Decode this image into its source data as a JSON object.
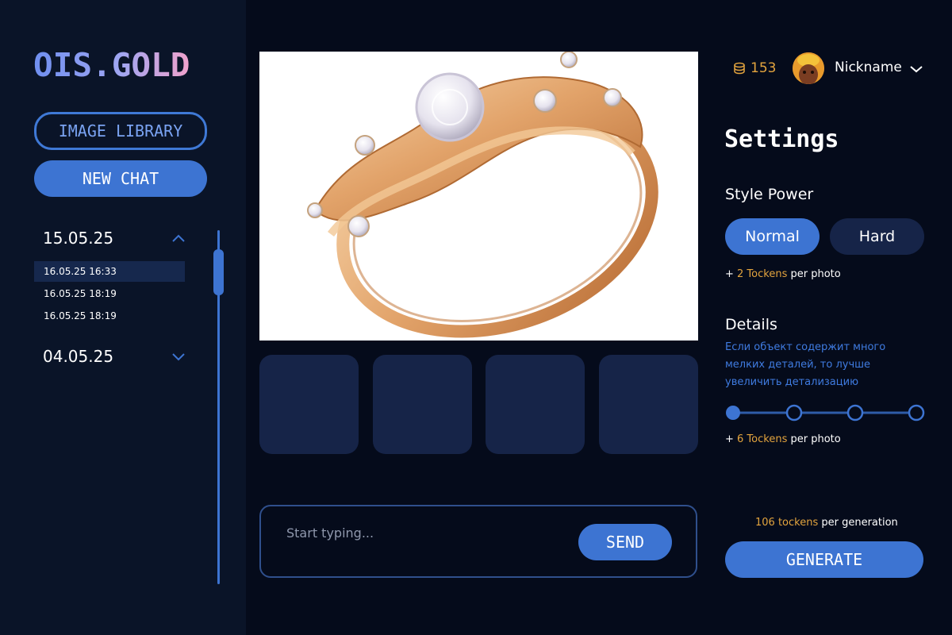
{
  "app": {
    "logo": "OIS.GOLD"
  },
  "sidebar": {
    "library_button": "IMAGE LIBRARY",
    "new_chat_button": "NEW CHAT",
    "groups": [
      {
        "date": "15.05.25",
        "expanded": true,
        "items": [
          "16.05.25 16:33",
          "16.05.25 18:19",
          "16.05.25 18:19"
        ],
        "active_index": 0
      },
      {
        "date": "04.05.25",
        "expanded": false
      }
    ]
  },
  "main": {
    "image_icon": "gold-ring-image",
    "thumbnails_count": 4,
    "chat": {
      "placeholder": "Start typing...",
      "value": "",
      "send_label": "SEND"
    }
  },
  "header": {
    "coin_icon": "coin-stack-icon",
    "coins": "153",
    "nickname": "Nickname"
  },
  "settings": {
    "title": "Settings",
    "style_power": {
      "title": "Style Power",
      "options": [
        "Normal",
        "Hard"
      ],
      "selected": "Normal",
      "note_prefix": "+ ",
      "note_tokens": "2 Tockens",
      "note_suffix": " per photo"
    },
    "details": {
      "title": "Details",
      "description": "Если объект содержит много мелких деталей, то лучше увеличить детализацию",
      "level": 1,
      "levels": 4,
      "note_prefix": "+ ",
      "note_tokens": "6 Tockens",
      "note_suffix": " per photo"
    },
    "generation": {
      "tokens": "106 tockens",
      "suffix": " per generation",
      "button": "GENERATE"
    }
  },
  "colors": {
    "accent": "#3d74d2",
    "background": "#050b1b",
    "sidebar": "#0a1428",
    "token_highlight": "#e3a43e",
    "muted_blue": "#3f7be0"
  }
}
